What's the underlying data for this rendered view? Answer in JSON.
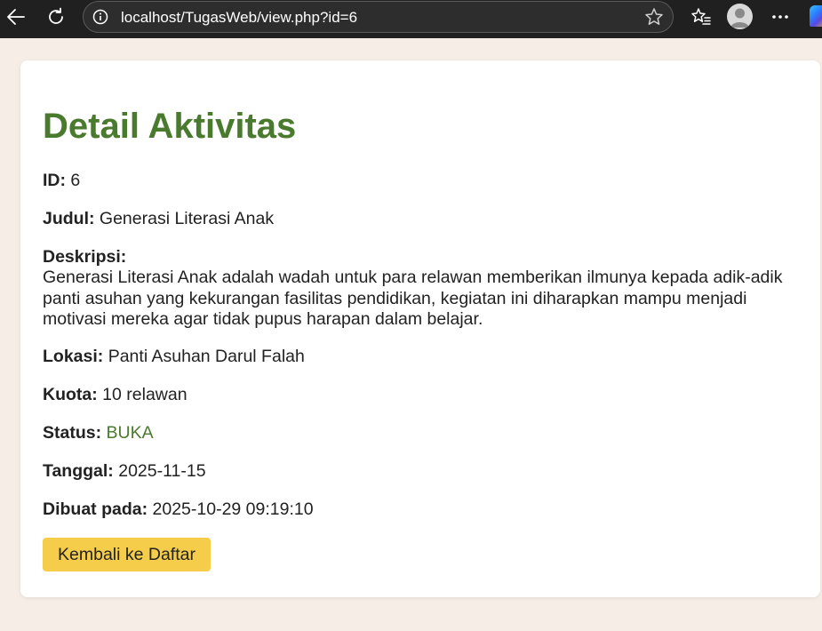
{
  "browser": {
    "url": "localhost/TugasWeb/view.php?id=6",
    "icons": {
      "back": "back-arrow-icon",
      "reload": "reload-icon",
      "info": "info-icon",
      "star": "star-icon",
      "favorites": "favorites-icon",
      "profile": "profile-avatar",
      "more": "more-icon",
      "copilot": "copilot-icon"
    }
  },
  "page": {
    "title": "Detail Aktivitas",
    "fields": {
      "id": {
        "label": "ID:",
        "value": "6"
      },
      "judul": {
        "label": "Judul:",
        "value": "Generasi Literasi Anak"
      },
      "deskripsi": {
        "label": "Deskripsi:",
        "value": "Generasi Literasi Anak adalah wadah untuk para relawan memberikan ilmunya kepada adik-adik panti asuhan yang kekurangan fasilitas pendidikan, kegiatan ini diharapkan mampu menjadi motivasi mereka agar tidak pupus harapan dalam belajar."
      },
      "lokasi": {
        "label": "Lokasi:",
        "value": "Panti Asuhan Darul Falah"
      },
      "kuota": {
        "label": "Kuota:",
        "value": "10 relawan"
      },
      "status": {
        "label": "Status:",
        "value": "BUKA"
      },
      "tanggal": {
        "label": "Tanggal:",
        "value": "2025-11-15"
      },
      "dibuat": {
        "label": "Dibuat pada:",
        "value": "2025-10-29 09:19:10"
      }
    },
    "back_button_label": "Kembali ke Daftar"
  },
  "colors": {
    "accent_green": "#4a7a2e",
    "button_yellow": "#f5cd4a",
    "page_background": "#f6ede6",
    "toolbar": "#202020"
  }
}
